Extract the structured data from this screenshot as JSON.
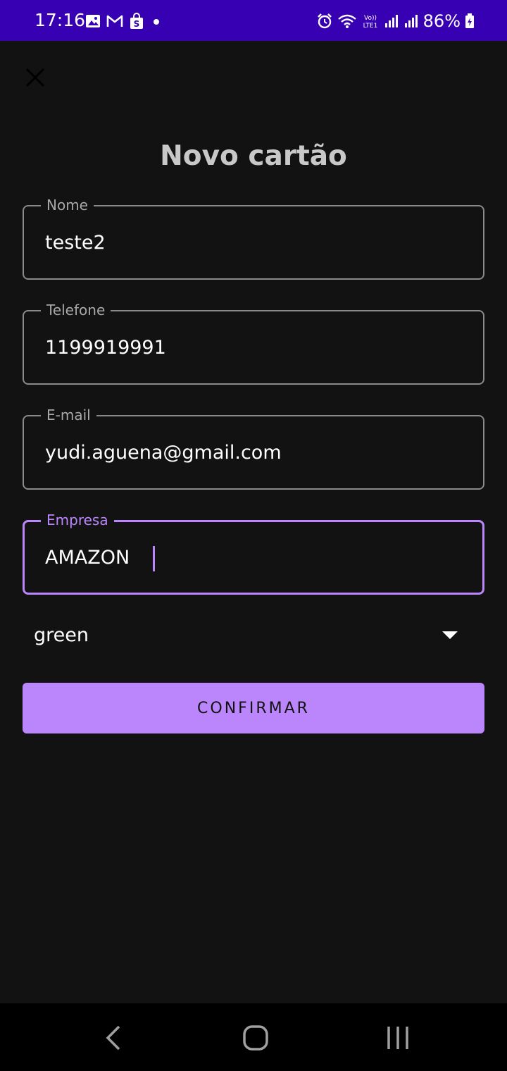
{
  "status_bar": {
    "time": "17:16",
    "battery": "86%",
    "left_icons": [
      "gallery-icon",
      "gmail-icon",
      "shopping-bag-icon",
      "dot-icon"
    ],
    "right_icons": [
      "alarm-icon",
      "wifi-icon",
      "volte-icon",
      "signal-icon",
      "signal-icon",
      "battery-charging-icon"
    ]
  },
  "header": {
    "close_icon": "close-icon",
    "title": "Novo cartão"
  },
  "form": {
    "nome": {
      "label": "Nome",
      "value": "teste2"
    },
    "telefone": {
      "label": "Telefone",
      "value": "1199919991"
    },
    "email": {
      "label": "E-mail",
      "value": "yudi.aguena@gmail.com"
    },
    "empresa": {
      "label": "Empresa",
      "value": "AMAZON"
    },
    "color_select": {
      "value": "green"
    },
    "confirm_label": "CONFIRMAR"
  },
  "theme": {
    "accent": "#bb86fc",
    "status_bar": "#3700b3",
    "background": "#121212"
  },
  "nav_bar": {
    "buttons": [
      "back-icon",
      "home-icon",
      "recents-icon"
    ]
  }
}
